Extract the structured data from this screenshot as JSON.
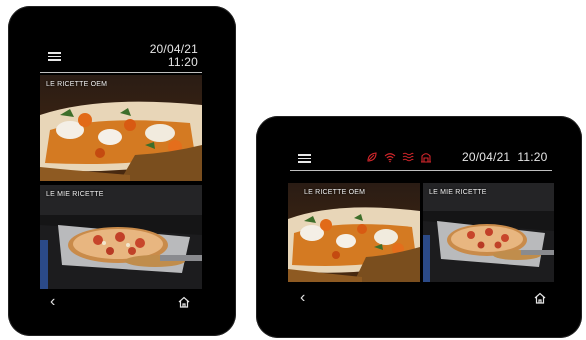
{
  "portrait": {
    "date": "20/04/21",
    "time": "11:20",
    "tiles": [
      {
        "label": "LE RICETTE OEM"
      },
      {
        "label": "LE MIE RICETTE"
      }
    ],
    "nav": {
      "back_icon": "chevron-left-icon",
      "home_icon": "home-icon"
    }
  },
  "landscape": {
    "datetime": "20/04/21  11:20",
    "status_icons": [
      "leaf-icon",
      "wifi-icon",
      "heating-icon",
      "oven-icon"
    ],
    "tiles": [
      {
        "label": "LE RICETTE OEM"
      },
      {
        "label": "LE MIE RICETTE"
      }
    ],
    "nav": {
      "back_icon": "chevron-left-icon",
      "home_icon": "home-icon"
    }
  },
  "colors": {
    "device_bezel": "#000000",
    "status_icon_red": "#d4262b",
    "text": "#e6e6e6"
  }
}
